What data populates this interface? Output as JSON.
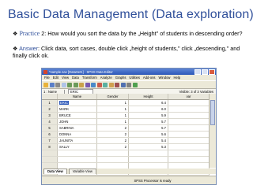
{
  "slide": {
    "title": "Basic Data Management (Data exploration)",
    "bullets": [
      {
        "lead": "Practice",
        "text": " 2: How would you sort the data by the „Height\" of students in descending order?"
      },
      {
        "lead": "Answer",
        "text": ": Click data, sort cases, double click „height of students,\" click „descending,\" and finally click ok."
      }
    ]
  },
  "window": {
    "title": "*sample.sav [DataSet1] - SPSS Data Editor",
    "menu": [
      "File",
      "Edit",
      "View",
      "Data",
      "Transform",
      "Analyze",
      "Graphs",
      "Utilities",
      "Add-ons",
      "Window",
      "Help"
    ],
    "cell_ref": "1 : Name",
    "cell_value": "ERIC",
    "visible_text": "Visible: 3 of 3 Variables",
    "columns": [
      "Name",
      "Gender",
      "Height",
      "var"
    ],
    "rows": [
      {
        "n": "1",
        "name": "ERIC",
        "gender": "1",
        "height": "6.4"
      },
      {
        "n": "2",
        "name": "MARK",
        "gender": "1",
        "height": "6.0"
      },
      {
        "n": "3",
        "name": "BRUCE",
        "gender": "1",
        "height": "5.9"
      },
      {
        "n": "4",
        "name": "JOHN",
        "gender": "1",
        "height": "5.7"
      },
      {
        "n": "5",
        "name": "SABRINA",
        "gender": "2",
        "height": "5.7"
      },
      {
        "n": "6",
        "name": "DONNA",
        "gender": "2",
        "height": "5.6"
      },
      {
        "n": "7",
        "name": "JAUNITA",
        "gender": "2",
        "height": "5.4"
      },
      {
        "n": "8",
        "name": "SALLY",
        "gender": "2",
        "height": "5.3"
      }
    ],
    "tabs": [
      "Data View",
      "Variable View"
    ],
    "status": "SPSS Processor is ready",
    "colors": {
      "titlebar": "#2d58b8",
      "heading": "#2f4f9a"
    }
  }
}
